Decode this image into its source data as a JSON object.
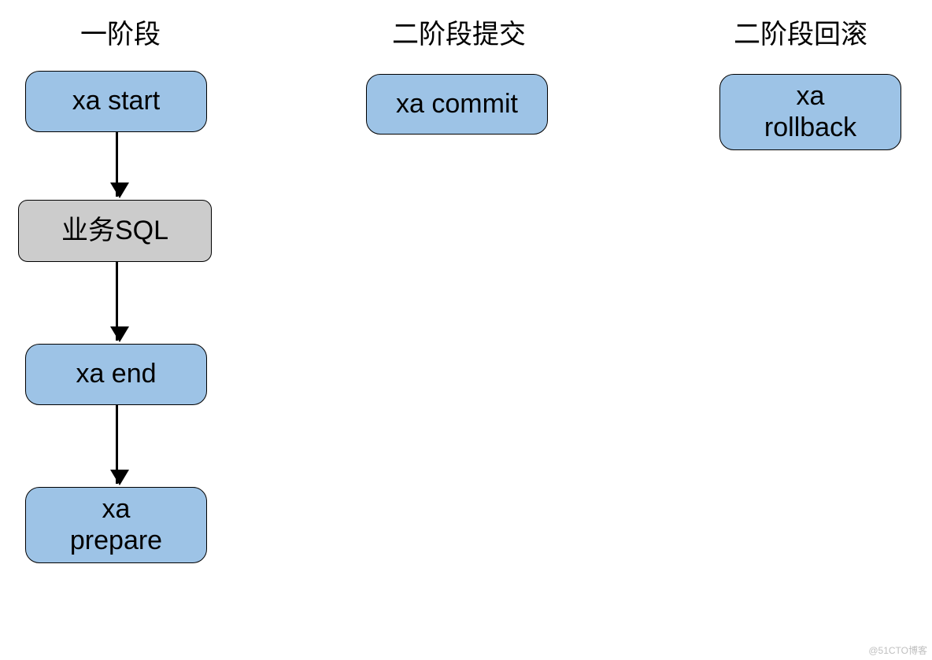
{
  "columns": {
    "phase1": {
      "title": "一阶段"
    },
    "phase2_commit": {
      "title": "二阶段提交"
    },
    "phase2_rollback": {
      "title": "二阶段回滚"
    }
  },
  "nodes": {
    "xa_start": "xa start",
    "biz_sql": "业务SQL",
    "xa_end": "xa end",
    "xa_prepare": "xa\nprepare",
    "xa_commit": "xa commit",
    "xa_rollback": "xa\nrollback"
  },
  "watermark": "@51CTO博客"
}
